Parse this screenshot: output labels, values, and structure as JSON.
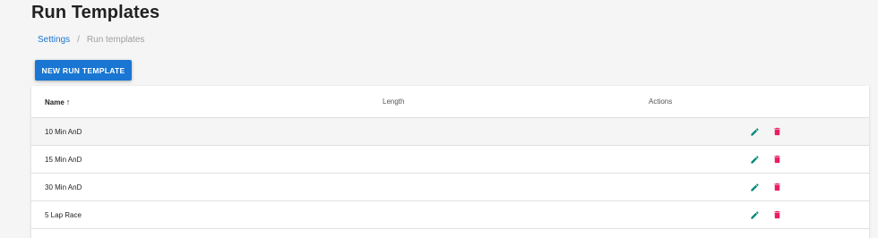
{
  "page": {
    "title": "Run Templates"
  },
  "breadcrumb": {
    "items": [
      {
        "label": "Settings"
      },
      {
        "label": "Run templates"
      }
    ],
    "separator": "/"
  },
  "toolbar": {
    "new_label": "NEW RUN TEMPLATE"
  },
  "table": {
    "columns": [
      {
        "label": "Name",
        "sort": "ascending"
      },
      {
        "label": "Length"
      },
      {
        "label": "Actions"
      }
    ],
    "rows": [
      {
        "name": "10 Min AnD",
        "length": ""
      },
      {
        "name": "15 Min AnD",
        "length": ""
      },
      {
        "name": "30 Min AnD",
        "length": ""
      },
      {
        "name": "5 Lap Race",
        "length": ""
      }
    ],
    "row_actions": [
      {
        "icon": "pencil-icon",
        "color": "#00897b"
      },
      {
        "icon": "trash-icon",
        "color": "#e91e63"
      }
    ]
  },
  "colors": {
    "primary": "#1976d2",
    "edit": "#00897b",
    "delete": "#e91e63",
    "background": "#f5f5f5"
  }
}
